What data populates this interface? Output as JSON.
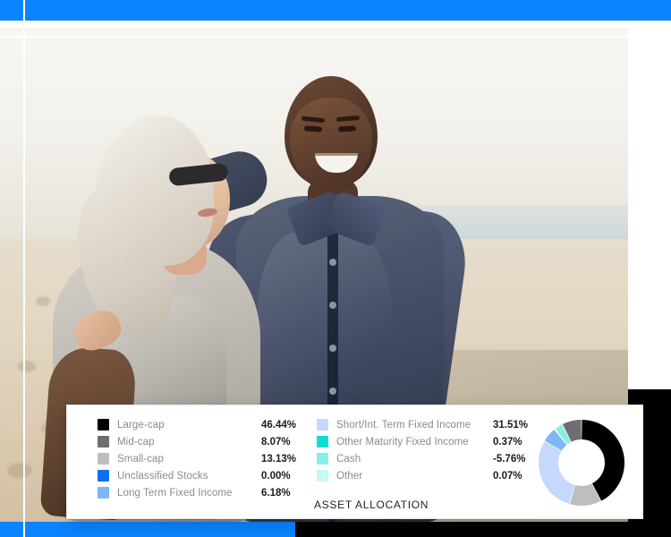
{
  "banner": {
    "color": "#0a84ff"
  },
  "photo": {
    "alt": "Smiling older couple embracing on a beach at sunset"
  },
  "card": {
    "title": "ASSET ALLOCATION",
    "legend_left": [
      {
        "label": "Large-cap",
        "value": "46.44%",
        "color": "#000000"
      },
      {
        "label": "Mid-cap",
        "value": "8.07%",
        "color": "#6e6e73"
      },
      {
        "label": "Small-cap",
        "value": "13.13%",
        "color": "#bdbdc2"
      },
      {
        "label": "Unclassified Stocks",
        "value": "0.00%",
        "color": "#0a70f5"
      },
      {
        "label": "Long Term Fixed Income",
        "value": "6.18%",
        "color": "#7eb6f7"
      }
    ],
    "legend_right": [
      {
        "label": "Short/Int. Term Fixed Income",
        "value": "31.51%",
        "color": "#c4d9fb"
      },
      {
        "label": "Other Maturity Fixed Income",
        "value": "0.37%",
        "color": "#0ae0d2"
      },
      {
        "label": "Cash",
        "value": "-5.76%",
        "color": "#86efe6"
      },
      {
        "label": "Other",
        "value": "0.07%",
        "color": "#c9f7f1"
      }
    ]
  },
  "chart_data": {
    "type": "pie",
    "title": "ASSET ALLOCATION",
    "variant": "donut",
    "legend_position": "left",
    "units": "percent",
    "categories": [
      "Large-cap",
      "Mid-cap",
      "Small-cap",
      "Unclassified Stocks",
      "Long Term Fixed Income",
      "Short/Int. Term Fixed Income",
      "Other Maturity Fixed Income",
      "Cash",
      "Other"
    ],
    "values": [
      46.44,
      8.07,
      13.13,
      0.0,
      6.18,
      31.51,
      0.37,
      -5.76,
      0.07
    ],
    "colors": [
      "#000000",
      "#6e6e73",
      "#bdbdc2",
      "#0a70f5",
      "#7eb6f7",
      "#c4d9fb",
      "#0ae0d2",
      "#86efe6",
      "#c9f7f1"
    ],
    "draw_order_clockwise_from_top": [
      {
        "name": "Large-cap",
        "value": 46.44,
        "color": "#000000"
      },
      {
        "name": "Small-cap",
        "value": 13.13,
        "color": "#bdbdc2"
      },
      {
        "name": "Short/Int. Term Fixed Income",
        "value": 31.51,
        "color": "#c4d9fb"
      },
      {
        "name": "Long Term Fixed Income",
        "value": 6.18,
        "color": "#7eb6f7"
      },
      {
        "name": "Other Maturity Fixed Income",
        "value": 0.37,
        "color": "#0ae0d2"
      },
      {
        "name": "Cash",
        "value": 3.5,
        "color": "#86efe6"
      },
      {
        "name": "Mid-cap",
        "value": 8.07,
        "color": "#6e6e73"
      }
    ],
    "notes": "Negative Cash (-5.76%) is rendered as a small positive-width turquoise wedge in the source image; Unclassified Stocks (0.00%) and Other (0.07%) are not visible."
  }
}
